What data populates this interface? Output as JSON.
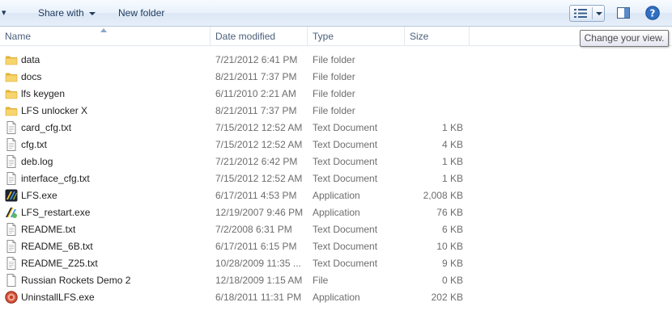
{
  "toolbar": {
    "share_label": "Share with",
    "newfolder_label": "New folder"
  },
  "headers": {
    "name": "Name",
    "date": "Date modified",
    "type": "Type",
    "size": "Size"
  },
  "tooltip": "Change your view.",
  "files": [
    {
      "name": "data",
      "date": "7/21/2012 6:41 PM",
      "type": "File folder",
      "size": "",
      "icon": "folder-icon"
    },
    {
      "name": "docs",
      "date": "8/21/2011 7:37 PM",
      "type": "File folder",
      "size": "",
      "icon": "folder-icon"
    },
    {
      "name": "lfs keygen",
      "date": "6/11/2010 2:21 AM",
      "type": "File folder",
      "size": "",
      "icon": "folder-icon"
    },
    {
      "name": "LFS unlocker X",
      "date": "8/21/2011 7:37 PM",
      "type": "File folder",
      "size": "",
      "icon": "folder-icon"
    },
    {
      "name": "card_cfg.txt",
      "date": "7/15/2012 12:52 AM",
      "type": "Text Document",
      "size": "1 KB",
      "icon": "text-document-icon"
    },
    {
      "name": "cfg.txt",
      "date": "7/15/2012 12:52 AM",
      "type": "Text Document",
      "size": "4 KB",
      "icon": "text-document-icon"
    },
    {
      "name": "deb.log",
      "date": "7/21/2012 6:42 PM",
      "type": "Text Document",
      "size": "1 KB",
      "icon": "text-document-icon"
    },
    {
      "name": "interface_cfg.txt",
      "date": "7/15/2012 12:52 AM",
      "type": "Text Document",
      "size": "1 KB",
      "icon": "text-document-icon"
    },
    {
      "name": "LFS.exe",
      "date": "6/17/2011 4:53 PM",
      "type": "Application",
      "size": "2,008 KB",
      "icon": "lfs-app-icon"
    },
    {
      "name": "LFS_restart.exe",
      "date": "12/19/2007 9:46 PM",
      "type": "Application",
      "size": "76 KB",
      "icon": "restart-app-icon"
    },
    {
      "name": "README.txt",
      "date": "7/2/2008 6:31 PM",
      "type": "Text Document",
      "size": "6 KB",
      "icon": "text-document-icon"
    },
    {
      "name": "README_6B.txt",
      "date": "6/17/2011 6:15 PM",
      "type": "Text Document",
      "size": "10 KB",
      "icon": "text-document-icon"
    },
    {
      "name": "README_Z25.txt",
      "date": "10/28/2009 11:35 ...",
      "type": "Text Document",
      "size": "9 KB",
      "icon": "text-document-icon"
    },
    {
      "name": "Russian Rockets Demo 2",
      "date": "12/18/2009 1:15 AM",
      "type": "File",
      "size": "0 KB",
      "icon": "blank-file-icon"
    },
    {
      "name": "UninstallLFS.exe",
      "date": "6/18/2011 11:31 PM",
      "type": "Application",
      "size": "202 KB",
      "icon": "uninstall-app-icon"
    }
  ]
}
